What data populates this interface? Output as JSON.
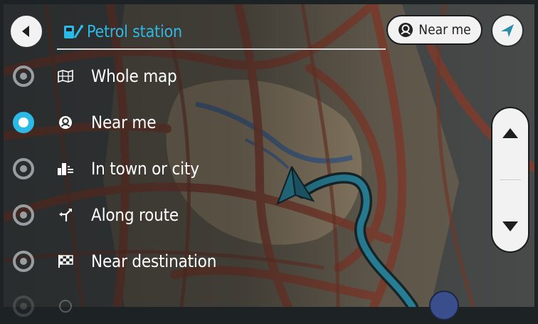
{
  "header": {
    "search_text": "Petrol station",
    "near_me_label": "Near me"
  },
  "options": [
    {
      "label": "Whole map",
      "selected": false,
      "icon": "map-grid-icon"
    },
    {
      "label": "Near me",
      "selected": true,
      "icon": "location-pin-icon"
    },
    {
      "label": "In town or city",
      "selected": false,
      "icon": "city-buildings-icon"
    },
    {
      "label": "Along route",
      "selected": false,
      "icon": "route-arrow-icon"
    },
    {
      "label": "Near destination",
      "selected": false,
      "icon": "checkered-flag-icon"
    }
  ],
  "icons": {
    "back": "back-arrow-icon",
    "search": "petrol-pump-icon",
    "near_me": "location-pin-icon",
    "location": "navigation-arrow-icon",
    "scroll_up": "chevron-up-icon",
    "scroll_down": "chevron-down-icon"
  },
  "colors": {
    "accent": "#2db9e6",
    "route": "#2a8ea8",
    "map_road": "#8a3f2e",
    "map_land": "#b9a480",
    "map_water": "#4e6a8f",
    "panel_bg": "#f2f2f2"
  }
}
